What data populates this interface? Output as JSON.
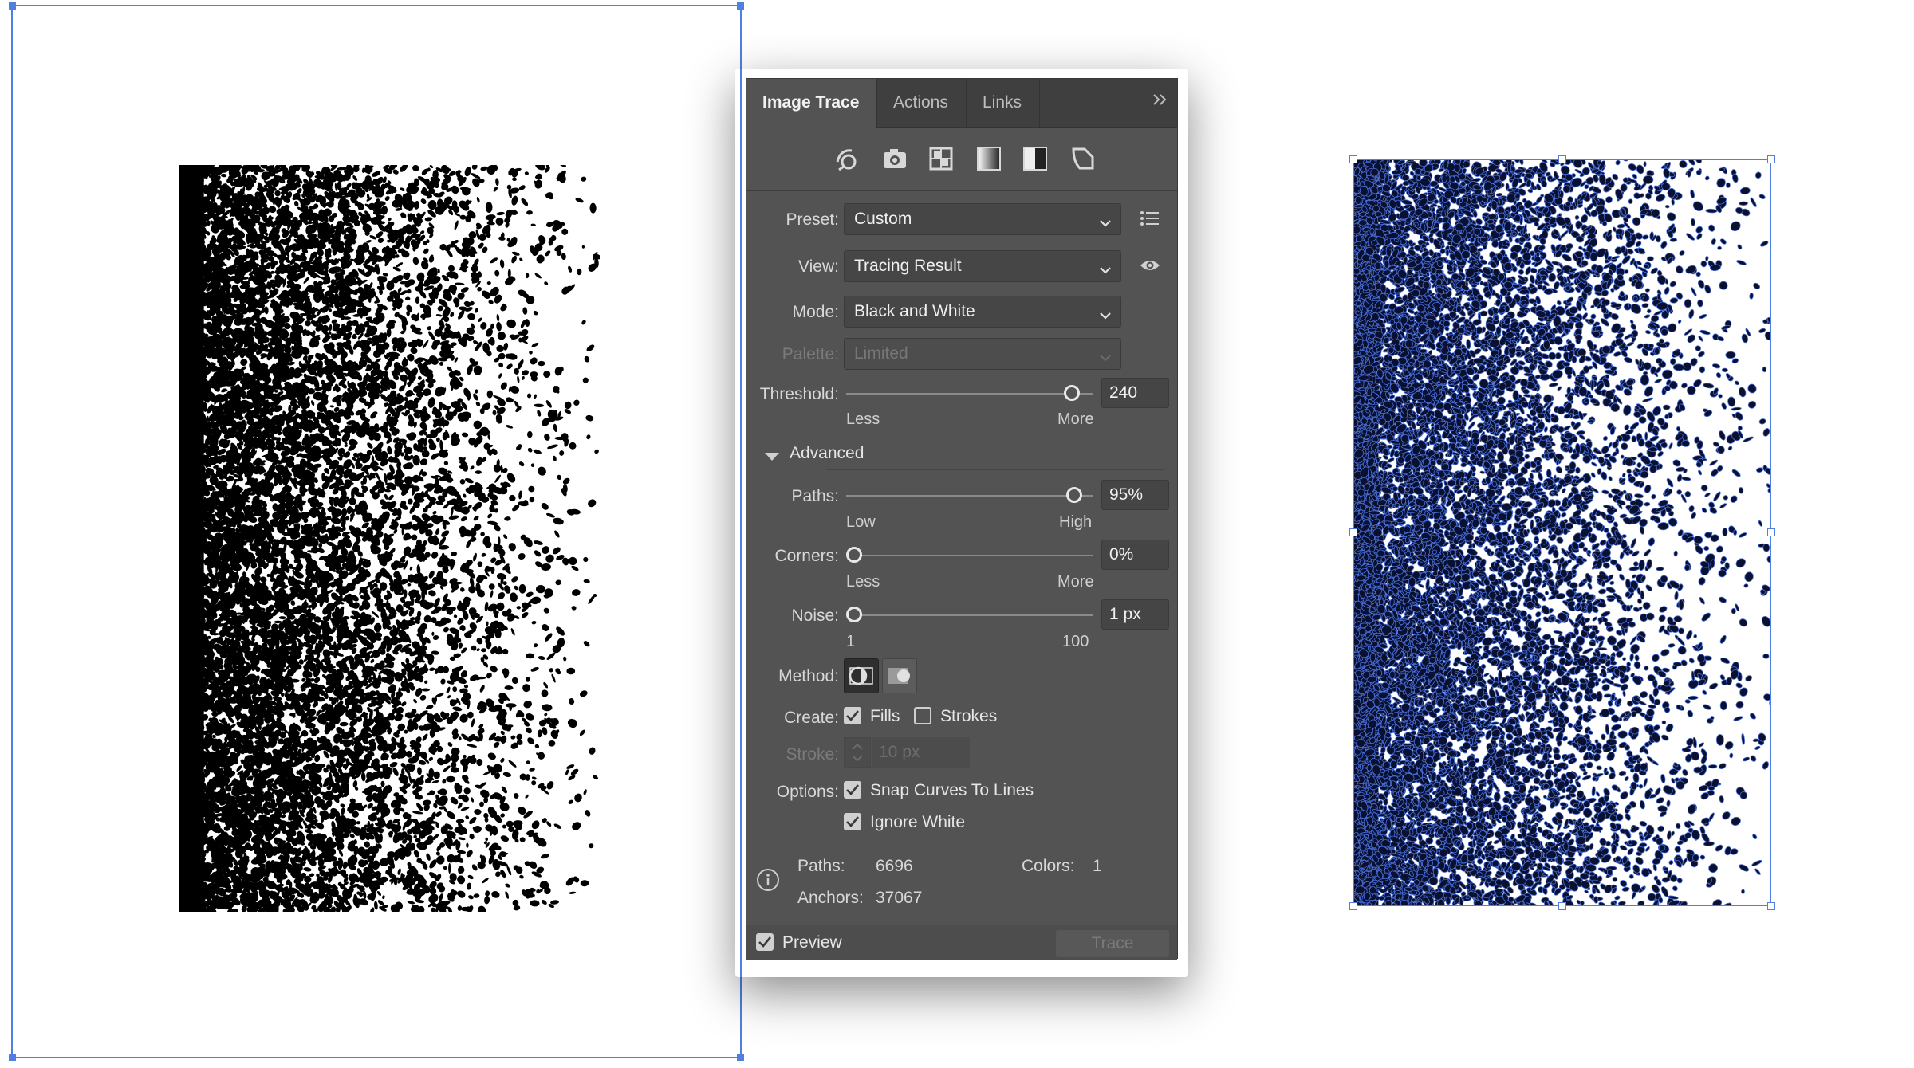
{
  "panel": {
    "tabs": [
      {
        "label": "Image Trace",
        "active": true
      },
      {
        "label": "Actions",
        "active": false
      },
      {
        "label": "Links",
        "active": false
      }
    ],
    "more_icon": "double-chevron-right-icon",
    "preset_icons": [
      "auto-color-icon",
      "high-color-icon",
      "low-color-icon",
      "grayscale-icon",
      "black-and-white-icon",
      "outline-icon"
    ],
    "preset": {
      "label": "Preset:",
      "value": "Custom"
    },
    "view": {
      "label": "View:",
      "value": "Tracing Result"
    },
    "mode": {
      "label": "Mode:",
      "value": "Black and White"
    },
    "palette": {
      "label": "Palette:",
      "value": "Limited"
    },
    "threshold": {
      "label": "Threshold:",
      "value": "240",
      "min_label": "Less",
      "max_label": "More",
      "level": 0.94
    },
    "advanced_label": "Advanced",
    "paths": {
      "label": "Paths:",
      "value": "95%",
      "min_label": "Low",
      "max_label": "High",
      "level": 0.95
    },
    "corners": {
      "label": "Corners:",
      "value": "0%",
      "min_label": "Less",
      "max_label": "More",
      "level": 0.0
    },
    "noise": {
      "label": "Noise:",
      "value": "1 px",
      "min_label": "1",
      "max_label": "100",
      "level": 0.0
    },
    "method": {
      "label": "Method:"
    },
    "create": {
      "label": "Create:",
      "fills_label": "Fills",
      "fills_checked": true,
      "strokes_label": "Strokes",
      "strokes_checked": false
    },
    "stroke": {
      "label": "Stroke:",
      "value": "10 px"
    },
    "options": {
      "label": "Options:",
      "snap_label": "Snap Curves To Lines",
      "snap_checked": true,
      "ignore_white_label": "Ignore White",
      "ignore_white_checked": true
    },
    "stats": {
      "paths_label": "Paths:",
      "paths_value": "6696",
      "colors_label": "Colors:",
      "colors_value": "1",
      "anchors_label": "Anchors:",
      "anchors_value": "37067"
    },
    "preview_label": "Preview",
    "preview_checked": true,
    "trace_label": "Trace"
  },
  "colors": {
    "panel_bg": "#535353",
    "tab_bg": "#3f3f3f",
    "selection_blue": "#4f7fe0"
  }
}
